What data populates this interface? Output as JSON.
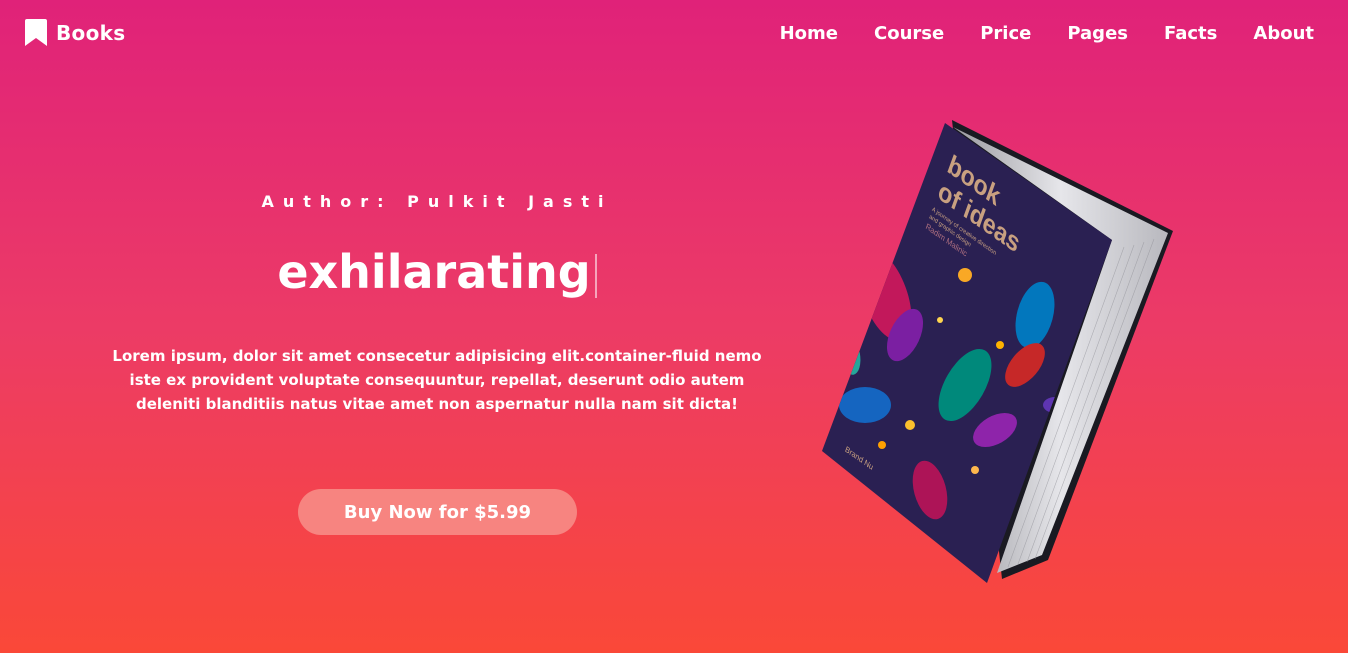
{
  "brand": {
    "name": "Books",
    "icon": "bookmark-icon"
  },
  "nav": {
    "items": [
      "Home",
      "Course",
      "Price",
      "Pages",
      "Facts",
      "About"
    ]
  },
  "hero": {
    "author": "Author: Pulkit Jasti",
    "headline": "exhilarating",
    "description": "Lorem ipsum, dolor sit amet consecetur adipisicing elit.container-fluid nemo iste ex provident voluptate consequuntur, repellat, deserunt odio autem deleniti blanditiis natus vitae amet non aspernatur nulla nam sit dicta!",
    "cta": "Buy Now for $5.99"
  },
  "book": {
    "title_line1": "book",
    "title_line2": "of ideas",
    "subtitle_line1": "A journey of creative direction",
    "subtitle_line2": "and graphic design",
    "author": "Radim Malinic",
    "publisher": "Brand Nu"
  },
  "colors": {
    "gradient_top": "#e02279",
    "gradient_bottom": "#fa4838",
    "button": "#f78480",
    "book_cover": "#2a2052"
  }
}
